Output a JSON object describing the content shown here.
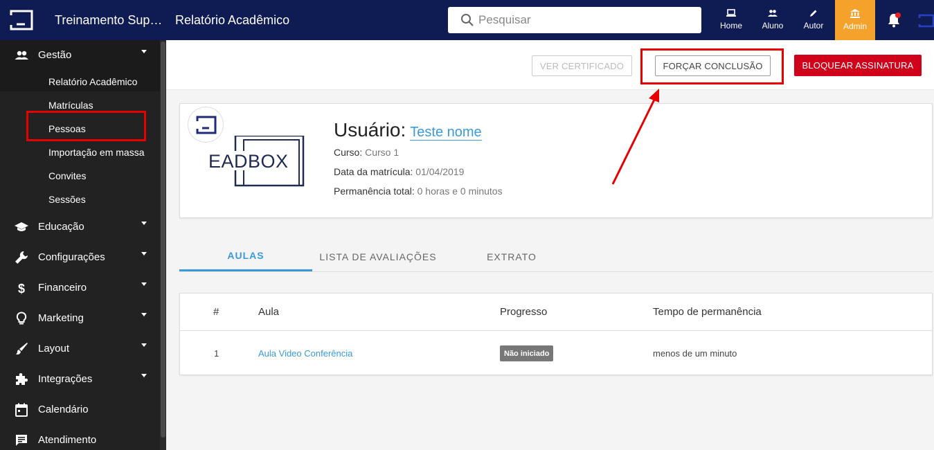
{
  "header": {
    "app_title": "Treinamento Suporte",
    "page_title": "Relatório Acadêmico",
    "search_placeholder": "Pesquisar",
    "nav": [
      {
        "label": "Home",
        "icon": "laptop-icon"
      },
      {
        "label": "Aluno",
        "icon": "people-icon"
      },
      {
        "label": "Autor",
        "icon": "pencil-icon"
      },
      {
        "label": "Admin",
        "icon": "bank-icon",
        "active": true
      }
    ],
    "accent_color": "#f5a22d",
    "bar_color": "#0f1c54"
  },
  "sidebar": {
    "groups": [
      {
        "label": "Gestão",
        "icon": "people-icon",
        "open": true
      },
      {
        "label": "Educação",
        "icon": "graduation-cap-icon"
      },
      {
        "label": "Configurações",
        "icon": "wrench-icon"
      },
      {
        "label": "Financeiro",
        "icon": "dollar-icon"
      },
      {
        "label": "Marketing",
        "icon": "lightbulb-icon"
      },
      {
        "label": "Layout",
        "icon": "brush-icon"
      },
      {
        "label": "Integrações",
        "icon": "puzzle-icon"
      },
      {
        "label": "Calendário",
        "icon": "calendar-icon"
      },
      {
        "label": "Atendimento",
        "icon": "chat-icon"
      }
    ],
    "gestao_items": [
      "Relatório Acadêmico",
      "Matrículas",
      "Pessoas",
      "Importação em massa",
      "Convites",
      "Sessões"
    ]
  },
  "actions": {
    "view_certificate": "VER CERTIFICADO",
    "force_completion": "FORÇAR CONCLUSÃO",
    "block_subscription": "BLOQUEAR ASSINATURA"
  },
  "profile": {
    "brand": "EADBOX",
    "user_label": "Usuário:",
    "user_name": "Teste nome",
    "course_label": "Curso:",
    "course_value": "Curso 1",
    "enrollment_label": "Data da matrícula:",
    "enrollment_value": "01/04/2019",
    "time_label": "Permanência total:",
    "time_value": "0 horas e 0 minutos"
  },
  "tabs": [
    "AULAS",
    "LISTA DE AVALIAÇÕES",
    "EXTRATO"
  ],
  "table": {
    "headers": [
      "#",
      "Aula",
      "Progresso",
      "Tempo de permanência"
    ],
    "rows": [
      {
        "num": "1",
        "lesson": "Aula Video Conferência",
        "progress": "Não iniciado",
        "time": "menos de um minuto"
      }
    ]
  }
}
